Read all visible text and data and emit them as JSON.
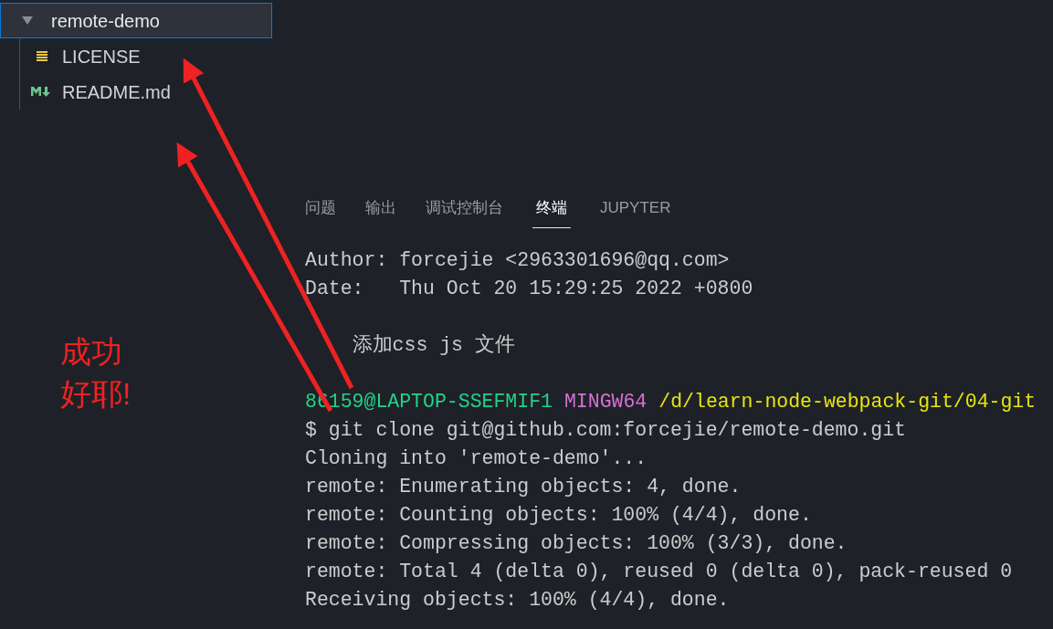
{
  "explorer": {
    "folder": {
      "name": "remote-demo",
      "expanded": true,
      "selected": true,
      "children": [
        {
          "name": "LICENSE",
          "kind": "license"
        },
        {
          "name": "README.md",
          "kind": "markdown"
        }
      ]
    }
  },
  "panel": {
    "tabs": [
      {
        "label": "问题",
        "selected": false
      },
      {
        "label": "输出",
        "selected": false
      },
      {
        "label": "调试控制台",
        "selected": false
      },
      {
        "label": "终端",
        "selected": true
      },
      {
        "label": "JUPYTER",
        "selected": false
      }
    ],
    "terminal_lines": [
      [
        {
          "kind": "plain",
          "text": "Author: forcejie <2963301696@qq.com>"
        }
      ],
      [
        {
          "kind": "plain",
          "text": "Date:   Thu Oct 20 15:29:25 2022 +0800"
        }
      ],
      [
        {
          "kind": "gap"
        },
        {
          "kind": "plain",
          "text": "    添加css js 文件"
        }
      ],
      [
        {
          "kind": "gap"
        },
        {
          "kind": "user",
          "text": "86159@LAPTOP-SSEFMIF1"
        },
        {
          "kind": "shell",
          "text": "MINGW64"
        },
        {
          "kind": "path",
          "text": "/d/learn-node-webpack-git/04-git"
        }
      ],
      [
        {
          "kind": "plain",
          "text": "$ git clone git@github.com:forcejie/remote-demo.git"
        }
      ],
      [
        {
          "kind": "plain",
          "text": "Cloning into 'remote-demo'..."
        }
      ],
      [
        {
          "kind": "plain",
          "text": "remote: Enumerating objects: 4, done."
        }
      ],
      [
        {
          "kind": "plain",
          "text": "remote: Counting objects: 100% (4/4), done."
        }
      ],
      [
        {
          "kind": "plain",
          "text": "remote: Compressing objects: 100% (3/3), done."
        }
      ],
      [
        {
          "kind": "plain",
          "text": "remote: Total 4 (delta 0), reused 0 (delta 0), pack-reused 0"
        }
      ],
      [
        {
          "kind": "plain",
          "text": "Receiving objects: 100% (4/4), done."
        }
      ]
    ]
  },
  "annotation": {
    "lines": [
      "成功",
      "好耶!"
    ]
  }
}
